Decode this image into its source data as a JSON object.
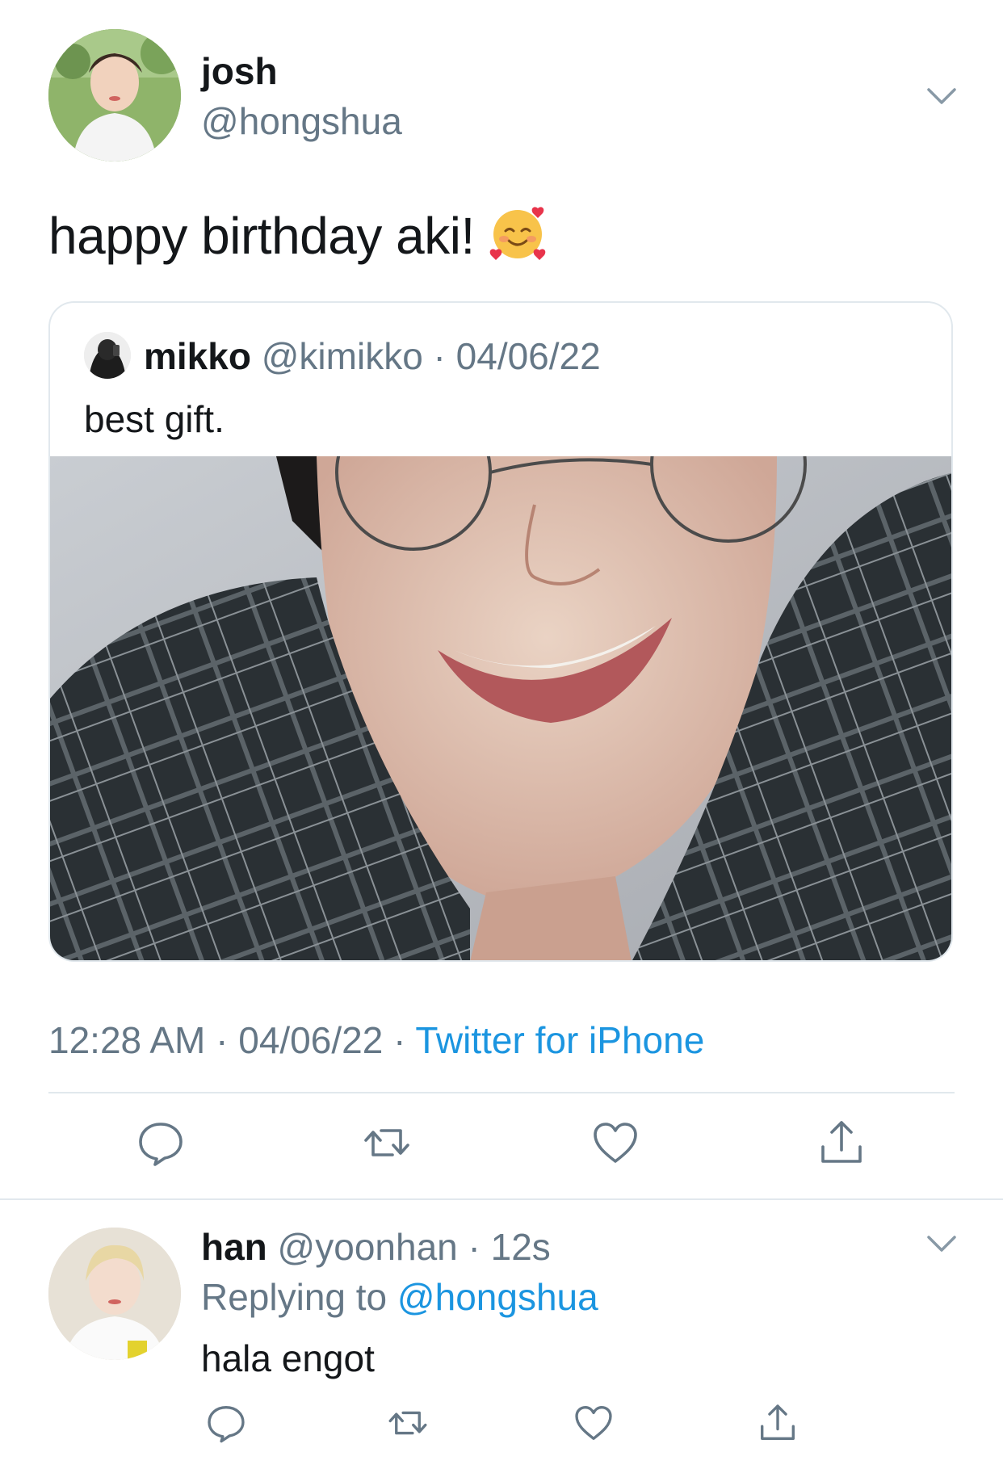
{
  "main_tweet": {
    "author_name": "josh",
    "author_handle": "@hongshua",
    "text": "happy birthday aki!",
    "emoji_icon": "smiling-face-with-hearts-icon",
    "timestamp": "12:28 AM · 04/06/22 · ",
    "source": "Twitter for iPhone"
  },
  "quoted_tweet": {
    "author_name": "mikko",
    "meta": " @kimikko · 04/06/22",
    "text": "best gift."
  },
  "reply_tweet": {
    "author_name": "han",
    "meta": " @yoonhan · 12s",
    "replying_prefix": "Replying to ",
    "replying_mention": "@hongshua",
    "text": "hala engot"
  },
  "actions": [
    "reply-icon",
    "retweet-icon",
    "like-icon",
    "share-icon"
  ],
  "colors": {
    "text_primary": "#14171a",
    "text_secondary": "#657786",
    "link_blue": "#1b95e0",
    "divider": "#e1e8ed"
  }
}
